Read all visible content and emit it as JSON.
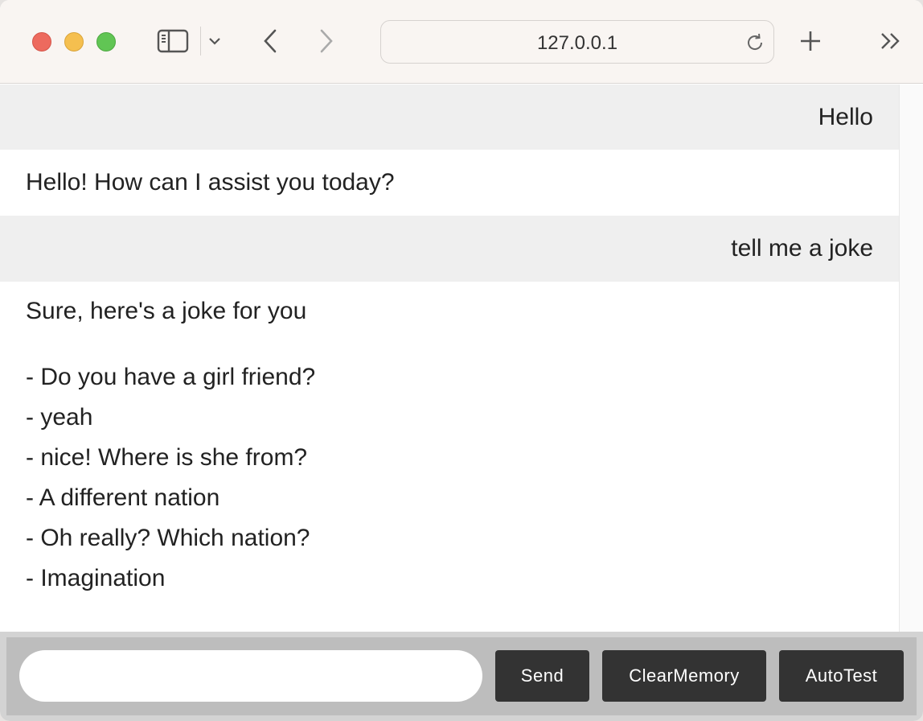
{
  "browser": {
    "url": "127.0.0.1",
    "icons": {
      "sidebar": "sidebar-icon",
      "dropdown": "chevron-down-icon",
      "back": "back-arrow-icon",
      "forward": "forward-arrow-icon",
      "reload": "reload-icon",
      "new_tab": "plus-icon",
      "more": "double-chevron-right-icon"
    }
  },
  "chat": {
    "messages": [
      {
        "role": "user",
        "text": "Hello"
      },
      {
        "role": "bot",
        "text": "Hello! How can I assist you today?"
      },
      {
        "role": "user",
        "text": "tell me a joke"
      },
      {
        "role": "bot",
        "lines": [
          "Sure, here's a joke for you",
          "- Do you have a girl friend?",
          "- yeah",
          "- nice! Where is she from?",
          "- A different nation",
          "- Oh really? Which nation?",
          "- Imagination"
        ]
      }
    ]
  },
  "controls": {
    "input_value": "",
    "send_label": "Send",
    "clear_label": "ClearMemory",
    "autotest_label": "AutoTest"
  },
  "colors": {
    "user_bg": "#efefef",
    "button_bg": "#333333",
    "bar_bg": "#bdbdbd"
  }
}
